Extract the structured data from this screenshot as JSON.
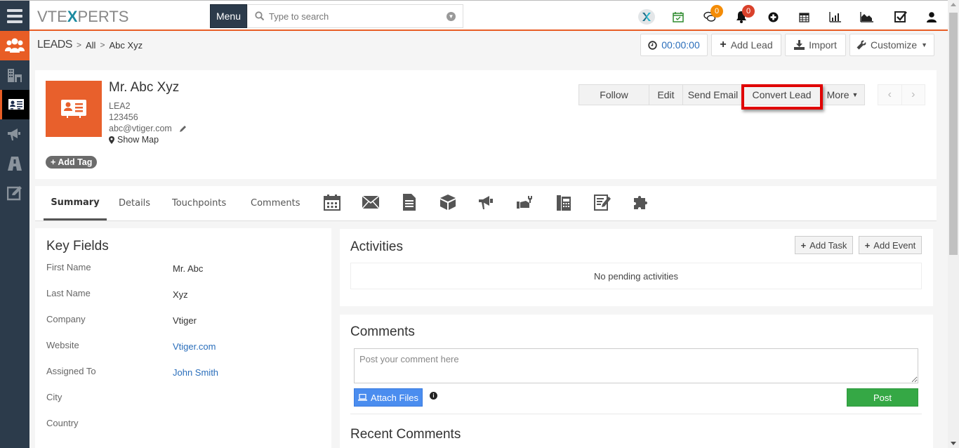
{
  "topbar": {
    "logo_left": "VTE",
    "logo_x": "X",
    "logo_right": "PERTS",
    "menu_label": "Menu",
    "search_placeholder": "Type to search",
    "icons": [
      {
        "name": "vtexperts-logo-icon"
      },
      {
        "name": "calendar-check-icon"
      },
      {
        "name": "chat-icon",
        "badge": "0",
        "badge_color": "#f48c06"
      },
      {
        "name": "bell-icon",
        "badge": "0",
        "badge_color": "#d9412b"
      },
      {
        "name": "plus-circle-icon"
      },
      {
        "name": "calendar-icon"
      },
      {
        "name": "bar-chart-icon"
      },
      {
        "name": "area-chart-icon"
      },
      {
        "name": "checkbox-icon"
      },
      {
        "name": "user-icon"
      }
    ]
  },
  "sidebar": {
    "items": [
      {
        "name": "leads-module-icon"
      },
      {
        "name": "organizations-icon"
      },
      {
        "name": "contact-card-icon"
      },
      {
        "name": "campaigns-megaphone-icon"
      },
      {
        "name": "road-icon"
      },
      {
        "name": "edit-square-icon"
      }
    ]
  },
  "breadcrumb": {
    "module": "LEADS",
    "filter": "All",
    "record": "Abc Xyz"
  },
  "header_buttons": {
    "timer": "00:00:00",
    "add_lead": "Add Lead",
    "import": "Import",
    "customize": "Customize"
  },
  "record": {
    "name": "Mr. Abc Xyz",
    "lead_no": "LEA2",
    "phone": "123456",
    "email": "abc@vtiger.com",
    "show_map": "Show Map",
    "add_tag": "Add Tag",
    "actions": {
      "follow": "Follow",
      "edit": "Edit",
      "send_email": "Send Email",
      "convert_lead": "Convert Lead",
      "more": "More"
    }
  },
  "tabs": {
    "summary": "Summary",
    "details": "Details",
    "touchpoints": "Touchpoints",
    "comments": "Comments",
    "icons": [
      "calendar-icon",
      "mail-icon",
      "document-icon",
      "box-icon",
      "megaphone-icon",
      "service-hand-icon",
      "phone-icon",
      "note-edit-icon",
      "puzzle-icon"
    ]
  },
  "key_fields": {
    "title": "Key Fields",
    "rows": [
      {
        "label": "First Name",
        "value": "Mr. Abc",
        "link": false
      },
      {
        "label": "Last Name",
        "value": "Xyz",
        "link": false
      },
      {
        "label": "Company",
        "value": "Vtiger",
        "link": false
      },
      {
        "label": "Website",
        "value": "Vtiger.com",
        "link": true
      },
      {
        "label": "Assigned To",
        "value": "John Smith",
        "link": true
      },
      {
        "label": "City",
        "value": "",
        "link": false
      },
      {
        "label": "Country",
        "value": "",
        "link": false
      }
    ]
  },
  "activities": {
    "title": "Activities",
    "add_task": "Add Task",
    "add_event": "Add Event",
    "empty_text": "No pending activities"
  },
  "comments": {
    "title": "Comments",
    "placeholder": "Post your comment here",
    "attach_files": "Attach Files",
    "post": "Post",
    "recent_title": "Recent Comments"
  }
}
